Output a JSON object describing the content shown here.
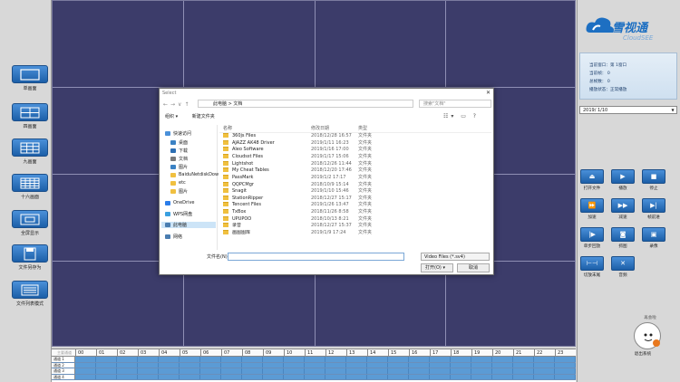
{
  "left_toolbar": [
    {
      "icon": "single-screen-icon",
      "label": "单画面"
    },
    {
      "icon": "four-screen-icon",
      "label": "四画面"
    },
    {
      "icon": "nine-screen-icon",
      "label": "九画面"
    },
    {
      "icon": "sixteen-screen-icon",
      "label": "十六画面"
    },
    {
      "icon": "fullscreen-icon",
      "label": "全屏显示"
    },
    {
      "icon": "save-icon",
      "label": "文件另存为"
    },
    {
      "icon": "file-list-icon",
      "label": "文件列表模式"
    }
  ],
  "timeline": {
    "header_first": "主要通道",
    "hours": [
      "00",
      "01",
      "02",
      "03",
      "04",
      "05",
      "06",
      "07",
      "08",
      "09",
      "10",
      "11",
      "12",
      "13",
      "14",
      "15",
      "16",
      "17",
      "18",
      "19",
      "20",
      "21",
      "22",
      "23"
    ],
    "channels": [
      "通道 1",
      "通道 2",
      "通道 3",
      "通道 4"
    ]
  },
  "logo": {
    "main": "雪视通",
    "sub": "CloudSEE"
  },
  "info": {
    "current_window": "当前窗口：第 1窗口",
    "current_frame": "当前帧：   0",
    "total_frames": "总帧数：   0",
    "play_status": "播放状态：正常播放"
  },
  "date": "2019/ 1/10",
  "right_buttons": [
    {
      "icon": "eject-icon",
      "label": "打开文件",
      "glyph": "⏏"
    },
    {
      "icon": "play-icon",
      "label": "播放",
      "glyph": "▶"
    },
    {
      "icon": "stop-icon",
      "label": "停止",
      "glyph": "■"
    },
    {
      "icon": "fast-forward-icon",
      "label": "加速",
      "glyph": "⏩"
    },
    {
      "icon": "slow-forward-icon",
      "label": "减速",
      "glyph": "▶▶"
    },
    {
      "icon": "frame-step-icon",
      "label": "帧前进",
      "glyph": "▶|"
    },
    {
      "icon": "single-frame-icon",
      "label": "单步回放",
      "glyph": "|▶"
    },
    {
      "icon": "snapshot-icon",
      "label": "抓图",
      "glyph": "◙"
    },
    {
      "icon": "record-icon",
      "label": "录像",
      "glyph": "▣"
    },
    {
      "icon": "clip-icon",
      "label": "切放末尾",
      "glyph": "⊢⊣"
    },
    {
      "icon": "mute-icon",
      "label": "音频",
      "glyph": "✕"
    }
  ],
  "exit": {
    "bubble": "再会啦",
    "label": "退出系统"
  },
  "dialog": {
    "title": "Select",
    "breadcrumb": "此电脑  >  文档",
    "search_placeholder": "搜索\"文档\"",
    "organize": "组织 ▾",
    "new_folder": "新建文件夹",
    "tree": [
      {
        "label": "快速访问",
        "color": "#4a90d9"
      },
      {
        "label": "桌面",
        "color": "#3b82c4"
      },
      {
        "label": "下载",
        "color": "#2d6fb3"
      },
      {
        "label": "文档",
        "color": "#7a7a7a"
      },
      {
        "label": "图片",
        "color": "#3b82c4"
      },
      {
        "label": "BaiduNetdiskDow",
        "color": "#f0c040"
      },
      {
        "label": "etc",
        "color": "#f0c040"
      },
      {
        "label": "图片",
        "color": "#f0c040"
      },
      {
        "label": "OneDrive",
        "color": "#2b7de9"
      },
      {
        "label": "WPS网盘",
        "color": "#3aa0e0"
      },
      {
        "label": "此电脑",
        "color": "#4a7db0"
      },
      {
        "label": "网络",
        "color": "#4a7db0"
      }
    ],
    "columns": {
      "name": "名称",
      "date": "修改日期",
      "type": "类型"
    },
    "files": [
      {
        "name": "360js Files",
        "date": "2018/12/28 16:57",
        "type": "文件夹"
      },
      {
        "name": "AJAZZ AK48 Driver",
        "date": "2019/1/11 16:23",
        "type": "文件夹"
      },
      {
        "name": "Aleo Software",
        "date": "2019/1/16 17:00",
        "type": "文件夹"
      },
      {
        "name": "Cloudsst Files",
        "date": "2019/1/17 15:06",
        "type": "文件夹"
      },
      {
        "name": "Lightshot",
        "date": "2018/12/26 11:44",
        "type": "文件夹"
      },
      {
        "name": "My Cheat Tables",
        "date": "2018/12/20 17:46",
        "type": "文件夹"
      },
      {
        "name": "PassMark",
        "date": "2019/1/2 17:17",
        "type": "文件夹"
      },
      {
        "name": "QQPCMgr",
        "date": "2018/10/9 15:14",
        "type": "文件夹"
      },
      {
        "name": "Snagit",
        "date": "2019/1/10 15:46",
        "type": "文件夹"
      },
      {
        "name": "StationRipper",
        "date": "2018/12/27 15:17",
        "type": "文件夹"
      },
      {
        "name": "Tencent Files",
        "date": "2019/1/26 13:47",
        "type": "文件夹"
      },
      {
        "name": "TxBox",
        "date": "2018/11/26 8:58",
        "type": "文件夹"
      },
      {
        "name": "UPUPOO",
        "date": "2018/10/13 8:21",
        "type": "文件夹"
      },
      {
        "name": "录音",
        "date": "2018/12/27 15:37",
        "type": "文件夹"
      },
      {
        "name": "画图图库",
        "date": "2019/1/9 17:24",
        "type": "文件夹"
      }
    ],
    "filename_label": "文件名(N):",
    "filetype": "Video Files (*.sv4)",
    "open": "打开(O)",
    "cancel": "取消"
  }
}
